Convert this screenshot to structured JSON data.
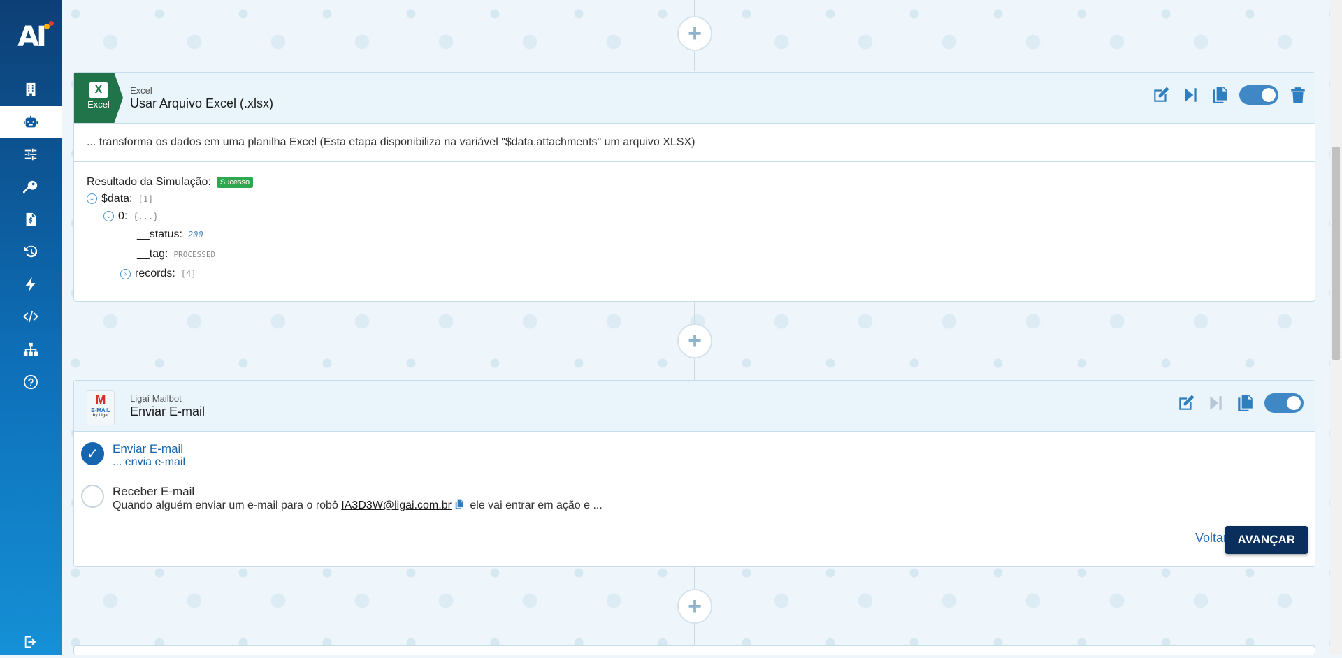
{
  "sidebar": {
    "logo_text": "AI",
    "items": [
      {
        "icon": "building-icon"
      },
      {
        "icon": "robot-icon",
        "active": true
      },
      {
        "icon": "sliders-icon"
      },
      {
        "icon": "key-icon"
      },
      {
        "icon": "invoice-icon"
      },
      {
        "icon": "history-icon"
      },
      {
        "icon": "lightning-icon"
      },
      {
        "icon": "code-icon"
      },
      {
        "icon": "network-icon"
      },
      {
        "icon": "help-icon"
      },
      {
        "icon": "logout-icon"
      }
    ]
  },
  "plus_label": "+",
  "excel_step": {
    "badge_label": "Excel",
    "subtitle": "Excel",
    "title": "Usar Arquivo Excel (.xlsx)",
    "description": "... transforma os dados em uma planilha Excel (Esta etapa disponibiliza na variável \"$data.attachments\" um arquivo XLSX)",
    "simulation_label": "Resultado da Simulação:",
    "simulation_status": "Sucesso",
    "tree": {
      "data_key": "$data:",
      "data_val": "[1]",
      "item_key": "0:",
      "item_val": "{...}",
      "status_key": "__status:",
      "status_val": "200",
      "tag_key": "__tag:",
      "tag_val": "PROCESSED",
      "records_key": "records:",
      "records_val": "[4]"
    }
  },
  "mail_step": {
    "badge_top": "M",
    "badge_label": "E-MAIL",
    "badge_by": "by Ligaí",
    "subtitle": "Ligaí Mailbot",
    "title": "Enviar E-mail",
    "options": [
      {
        "title": "Enviar E-mail",
        "sub": "... envia e-mail",
        "checked": true
      },
      {
        "title": "Receber E-mail",
        "sub_prefix": "Quando alguém enviar um e-mail para o robô ",
        "email": "IA3D3W@ligai.com.br",
        "sub_suffix": " ele vai entrar em ação e ...",
        "checked": false
      }
    ],
    "back_label": "Voltar",
    "next_label": "AVANÇAR"
  }
}
